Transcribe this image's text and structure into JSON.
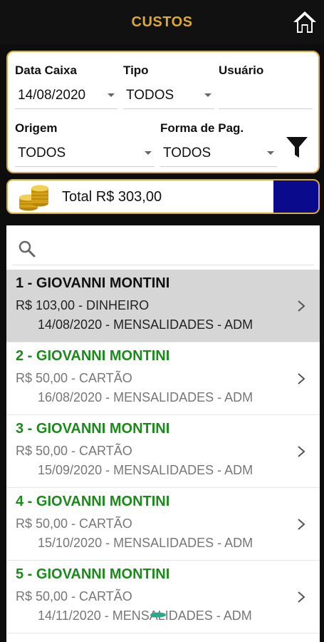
{
  "header": {
    "title": "CUSTOS"
  },
  "filters": {
    "data_caixa": {
      "label": "Data Caixa",
      "value": "14/08/2020"
    },
    "tipo": {
      "label": "Tipo",
      "value": "TODOS"
    },
    "usuario": {
      "label": "Usuário",
      "value": ""
    },
    "origem": {
      "label": "Origem",
      "value": "TODOS"
    },
    "forma_pag": {
      "label": "Forma de Pag.",
      "value": "TODOS"
    }
  },
  "total": {
    "label": "Total R$ 303,00",
    "accent_color": "#0a0a8c"
  },
  "search": {
    "placeholder": ""
  },
  "items": [
    {
      "title": "1 - GIOVANNI MONTINI",
      "line1": "R$ 103,00 - DINHEIRO",
      "line2": "14/08/2020 - MENSALIDADES - ADM",
      "selected": true
    },
    {
      "title": "2 - GIOVANNI MONTINI",
      "line1": "R$ 50,00 - CARTÃO",
      "line2": "16/08/2020 - MENSALIDADES - ADM"
    },
    {
      "title": "3 - GIOVANNI MONTINI",
      "line1": "R$ 50,00 - CARTÃO",
      "line2": "15/09/2020 - MENSALIDADES - ADM"
    },
    {
      "title": "4 - GIOVANNI MONTINI",
      "line1": "R$ 50,00 - CARTÃO",
      "line2": "15/10/2020 - MENSALIDADES - ADM"
    },
    {
      "title": "5 - GIOVANNI MONTINI",
      "line1": "R$ 50,00 - CARTÃO",
      "line2": "14/11/2020 - MENSALIDADES - ADM"
    }
  ],
  "colors": {
    "brand_gold": "#d9a93a",
    "paid_green": "#1a8a1a"
  }
}
